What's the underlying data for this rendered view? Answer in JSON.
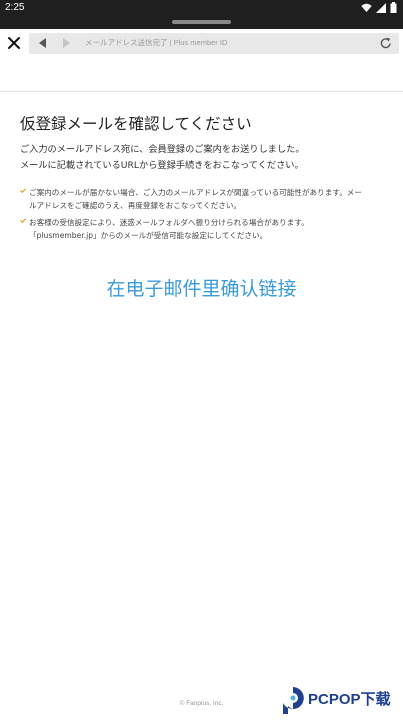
{
  "status_bar": {
    "time": "2:25",
    "icons": [
      "wifi-icon",
      "signal-icon",
      "battery-icon"
    ]
  },
  "toolbar": {
    "page_title": "メールアドレス送信完了 | Plus member ID"
  },
  "content": {
    "heading": "仮登録メールを確認してください",
    "intro_lines": [
      "ご入力のメールアドレス宛に、会員登録のご案内をお送りしました。",
      "メールに記載されているURLから登録手続きをおこなってください。"
    ],
    "notes": [
      {
        "lines": [
          "ご案内のメールが届かない場合、ご入力のメールアドレスが間違っている可能性があります。メー",
          "ルアドレスをご確認のうえ、再度登録をおこなってください。"
        ]
      },
      {
        "lines": [
          "お客様の受信設定により、迷惑メールフォルダへ振り分けられる場合があります。",
          "「plusmember.jp」からのメールが受信可能な設定にしてください。"
        ]
      }
    ],
    "confirm_text": "在电子邮件里确认链接"
  },
  "footer": {
    "copyright": "© Fanplus, Inc."
  },
  "watermark": {
    "brand": "PCPOP下载"
  },
  "colors": {
    "accent": "#3a9bd9",
    "check": "#e8a23a",
    "status_bar": "#1f1f1f",
    "url_bar": "#e8e8e8"
  }
}
